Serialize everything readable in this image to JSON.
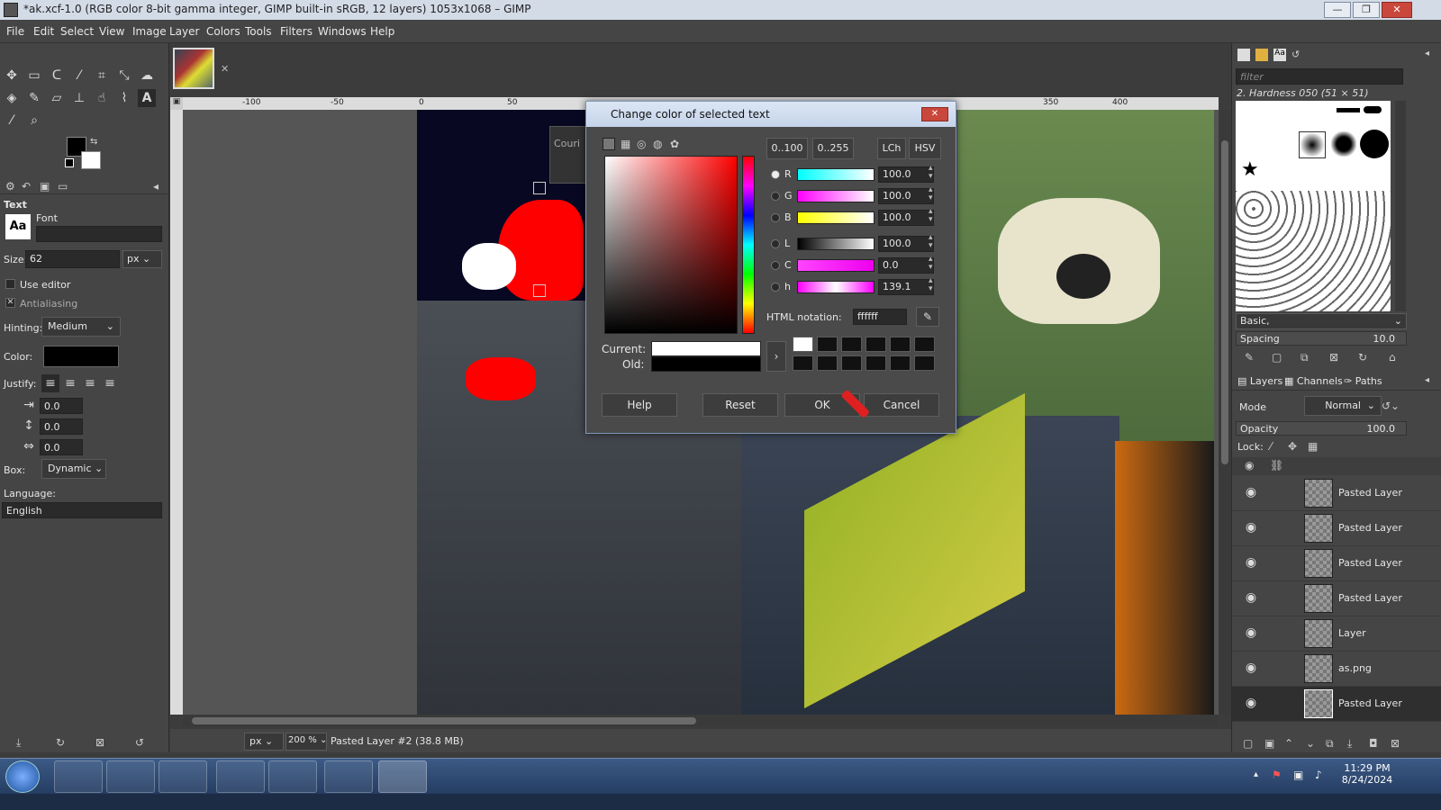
{
  "window": {
    "title": "*ak.xcf-1.0 (RGB color 8-bit gamma integer, GIMP built-in sRGB, 12 layers) 1053x1068 – GIMP",
    "minimize": "—",
    "restore": "❐",
    "close": "✕"
  },
  "menu": [
    "File",
    "Edit",
    "Select",
    "View",
    "Image",
    "Layer",
    "Colors",
    "Tools",
    "Filters",
    "Windows",
    "Help"
  ],
  "tool_options": {
    "header": "Text",
    "font_label": "Font",
    "font_icon": "Aa",
    "font_value": "",
    "size_label": "Size:",
    "size_value": "62",
    "size_unit": "px",
    "use_editor": "Use editor",
    "antialiasing": "Antialiasing",
    "hinting_label": "Hinting:",
    "hinting_value": "Medium",
    "color_label": "Color:",
    "justify_label": "Justify:",
    "indent_value": "0.0",
    "line_spacing_value": "0.0",
    "letter_spacing_value": "0.0",
    "box_label": "Box:",
    "box_value": "Dynamic",
    "language_label": "Language:",
    "language_value": "English"
  },
  "ruler": {
    "marks": [
      "-100",
      "-50",
      "0",
      "50",
      "350",
      "400"
    ]
  },
  "canvas": {
    "text_box_font": "Couri"
  },
  "status": {
    "unit": "px",
    "zoom": "200 %",
    "layer_info": "Pasted Layer #2 (38.8 MB)"
  },
  "dialog": {
    "title": "Change color of selected text",
    "btn_0_100": "0..100",
    "btn_0_255": "0..255",
    "btn_lch": "LCh",
    "btn_hsv": "HSV",
    "channels": [
      {
        "label": "R",
        "value": "100.0"
      },
      {
        "label": "G",
        "value": "100.0"
      },
      {
        "label": "B",
        "value": "100.0"
      },
      {
        "label": "L",
        "value": "100.0"
      },
      {
        "label": "C",
        "value": "0.0"
      },
      {
        "label": "h",
        "value": "139.1"
      }
    ],
    "html_label": "HTML notation:",
    "html_value": "ffffff",
    "current_label": "Current:",
    "old_label": "Old:",
    "current_color": "#ffffff",
    "old_color": "#000000",
    "help": "Help",
    "reset": "Reset",
    "ok": "OK",
    "cancel": "Cancel"
  },
  "dock": {
    "filter_placeholder": "filter",
    "brush_name": "2. Hardness 050 (51 × 51)",
    "preset": "Basic,",
    "spacing_label": "Spacing",
    "spacing_value": "10.0",
    "tabs": [
      "Layers",
      "Channels",
      "Paths"
    ],
    "mode_label": "Mode",
    "mode_value": "Normal",
    "opacity_label": "Opacity",
    "opacity_value": "100.0",
    "lock_label": "Lock:",
    "layers": [
      "Pasted Layer",
      "Pasted Layer",
      "Pasted Layer",
      "Pasted Layer",
      "Layer",
      "as.png",
      "Pasted Layer"
    ]
  },
  "taskbar": {
    "time": "11:29 PM",
    "date": "8/24/2024"
  }
}
